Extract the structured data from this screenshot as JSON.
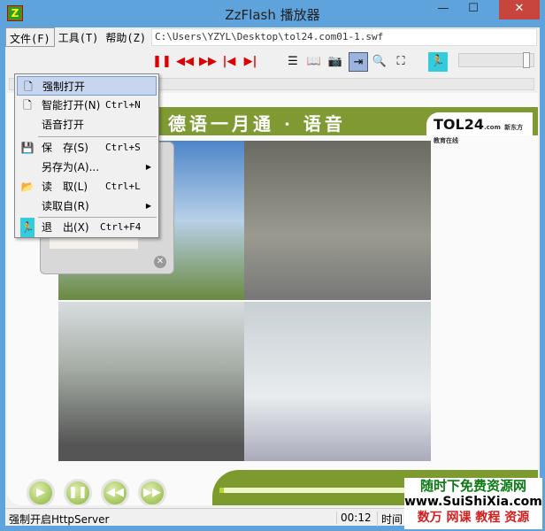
{
  "window": {
    "title": "ZzFlash 播放器",
    "app_icon": "Z",
    "minimize": "—",
    "maximize": "☐",
    "close": "✕"
  },
  "menubar": {
    "items": [
      {
        "label": "文件(F)"
      },
      {
        "label": "工具(T)"
      },
      {
        "label": "帮助(Z)"
      }
    ]
  },
  "address": {
    "value": "C:\\Users\\YZYL\\Desktop\\tol24.com01-1.swf"
  },
  "file_menu": {
    "items": [
      {
        "label": "强制打开",
        "shortcut": ""
      },
      {
        "label": "智能打开(N)",
        "shortcut": "Ctrl+N"
      },
      {
        "label": "语音打开",
        "shortcut": ""
      },
      {
        "label": "保　存(S)",
        "shortcut": "Ctrl+S"
      },
      {
        "label": "另存为(A)...",
        "shortcut": ""
      },
      {
        "label": "读　取(L)",
        "shortcut": "Ctrl+L"
      },
      {
        "label": "读取自(R)",
        "shortcut": ""
      },
      {
        "label": "退　出(X)",
        "shortcut": "Ctrl+F4"
      }
    ]
  },
  "flash": {
    "header": "德语一月通 · 语音",
    "logo": "TOL24",
    "logo_suffix": ".com",
    "logo_sub": "新东方教育在线",
    "progress": 0.01
  },
  "status": {
    "message": "强制开启HttpServer",
    "time": "00:12",
    "time_label": "时间"
  },
  "watermark": {
    "line1": "随时下免费资源网",
    "line2": "www.SuiShiXia.com",
    "line3": "数万 网课 教程 资源"
  }
}
